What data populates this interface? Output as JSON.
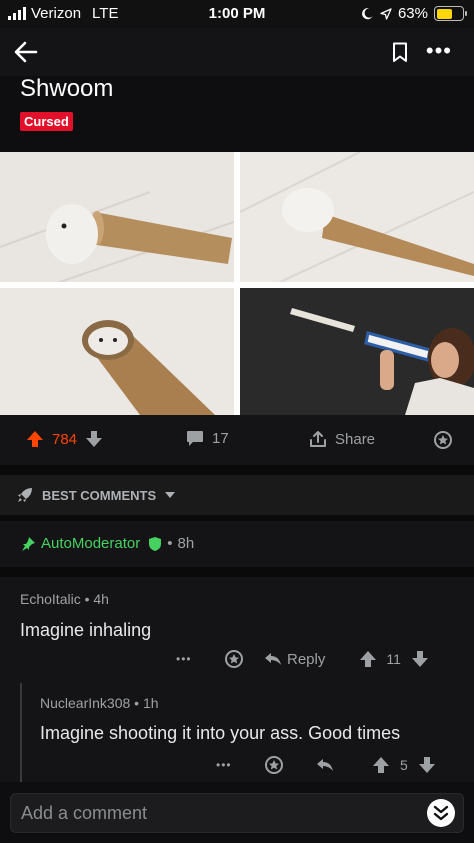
{
  "status_bar": {
    "carrier": "Verizon",
    "network": "LTE",
    "time": "1:00 PM",
    "battery": "63%",
    "battery_level": 0.63
  },
  "nav": {
    "back_icon": "arrow-left-icon",
    "bookmark_icon": "bookmark-icon",
    "more_icon": "more-horizontal-icon",
    "more_glyph": "•••"
  },
  "post": {
    "title": "Shwoom",
    "flair": "Cursed",
    "flair_color": "#e3102b"
  },
  "actions": {
    "upvotes": "784",
    "comments": "17",
    "share": "Share",
    "accent": "#ff4500"
  },
  "sort": {
    "label": "BEST COMMENTS"
  },
  "automod": {
    "author": "AutoModerator",
    "age": "8h",
    "color": "#46d160"
  },
  "comments": [
    {
      "author": "EchoItalic",
      "age": "4h",
      "body": "Imagine inhaling",
      "reply_label": "Reply",
      "score": "11"
    },
    {
      "author": "NuclearInk308",
      "age": "1h",
      "body": "Imagine shooting it into your ass. Good times",
      "score": "5"
    }
  ],
  "composer": {
    "placeholder": "Add a comment"
  },
  "separator": "•"
}
